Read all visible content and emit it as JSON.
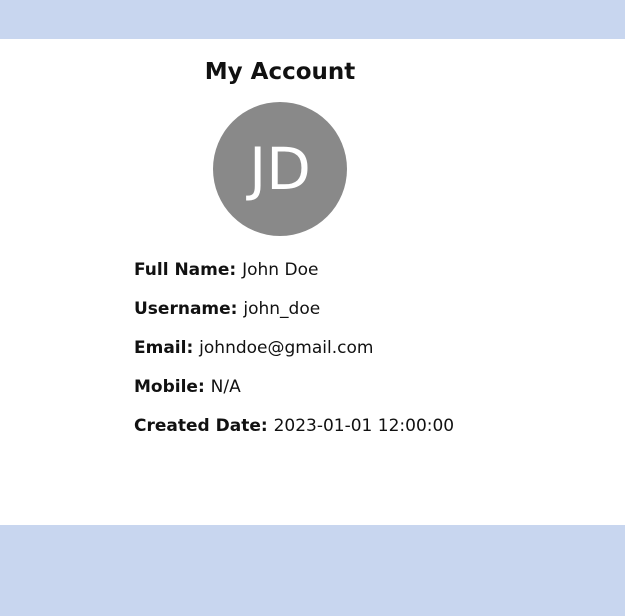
{
  "header": {
    "title": "My Account"
  },
  "avatar": {
    "initials": "JD",
    "color": "#898989"
  },
  "profile": {
    "fields": [
      {
        "label": "Full Name:",
        "value": "John Doe"
      },
      {
        "label": "Username:",
        "value": "john_doe"
      },
      {
        "label": "Email:",
        "value": "johndoe@gmail.com"
      },
      {
        "label": "Mobile:",
        "value": "N/A"
      },
      {
        "label": "Created Date:",
        "value": "2023-01-01 12:00:00"
      }
    ]
  },
  "colors": {
    "page_background": "#c8d6ef",
    "panel_background": "#ffffff"
  }
}
